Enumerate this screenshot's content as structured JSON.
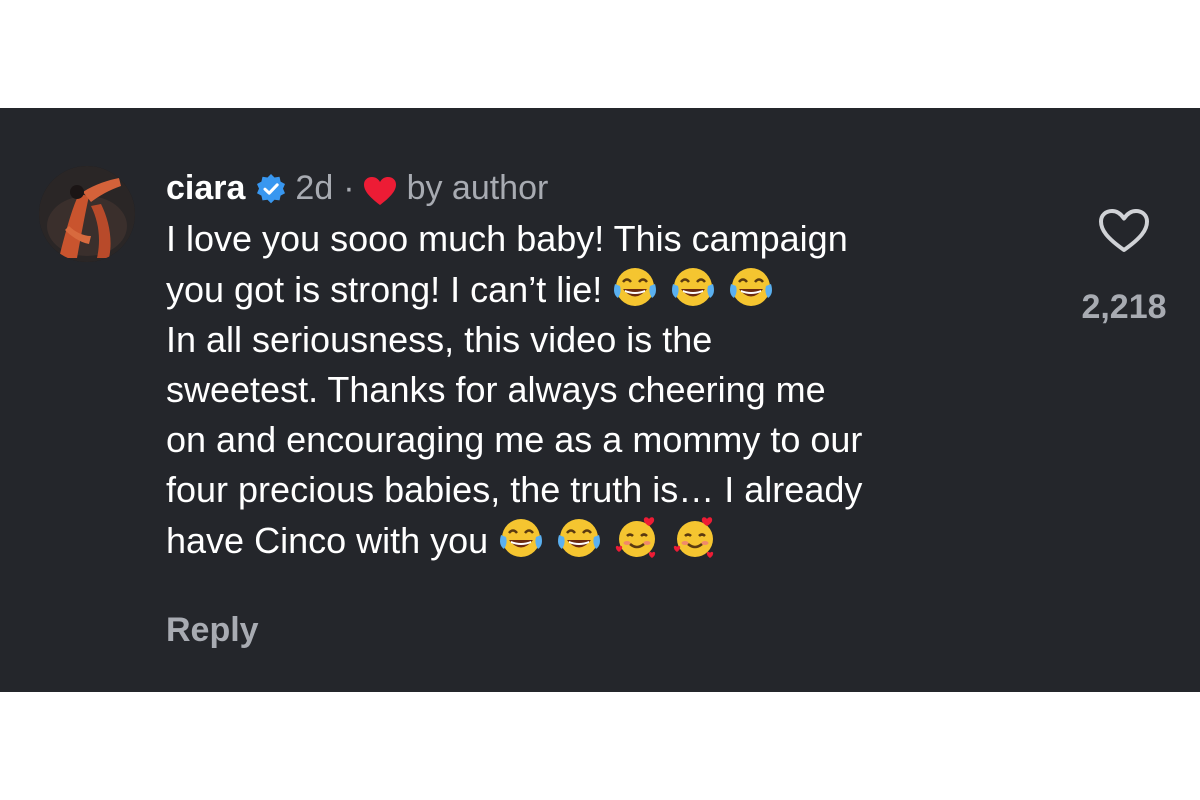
{
  "comment": {
    "username": "ciara",
    "verified_icon": "verified-badge-icon",
    "time_ago": "2d",
    "separator": "·",
    "liked_by_author_icon": "heart-filled-icon",
    "liked_by_author_label": "by author",
    "lines": [
      {
        "text": "I love you sooo much baby! This campaign",
        "emojis": []
      },
      {
        "text": "you got is strong! I can’t lie!",
        "emojis": [
          "laughing-tears-emoji",
          "laughing-tears-emoji",
          "laughing-tears-emoji"
        ]
      },
      {
        "text": "In all seriousness, this video is the",
        "emojis": []
      },
      {
        "text": "sweetest. Thanks for always cheering me",
        "emojis": []
      },
      {
        "text": "on and encouraging me as a mommy to our",
        "emojis": []
      },
      {
        "text": "four precious babies, the truth is… I already",
        "emojis": []
      },
      {
        "text": "have Cinco with you",
        "emojis": [
          "laughing-tears-emoji",
          "laughing-tears-emoji",
          "smiling-face-hearts-emoji",
          "smiling-face-hearts-emoji"
        ]
      }
    ],
    "reply_label": "Reply",
    "like_icon": "heart-outline-icon",
    "like_count": "2,218",
    "colors": {
      "background": "#24262b",
      "text": "#ffffff",
      "muted": "#a8abb2",
      "verified": "#3897f0",
      "heart": "#ed1c35"
    }
  }
}
